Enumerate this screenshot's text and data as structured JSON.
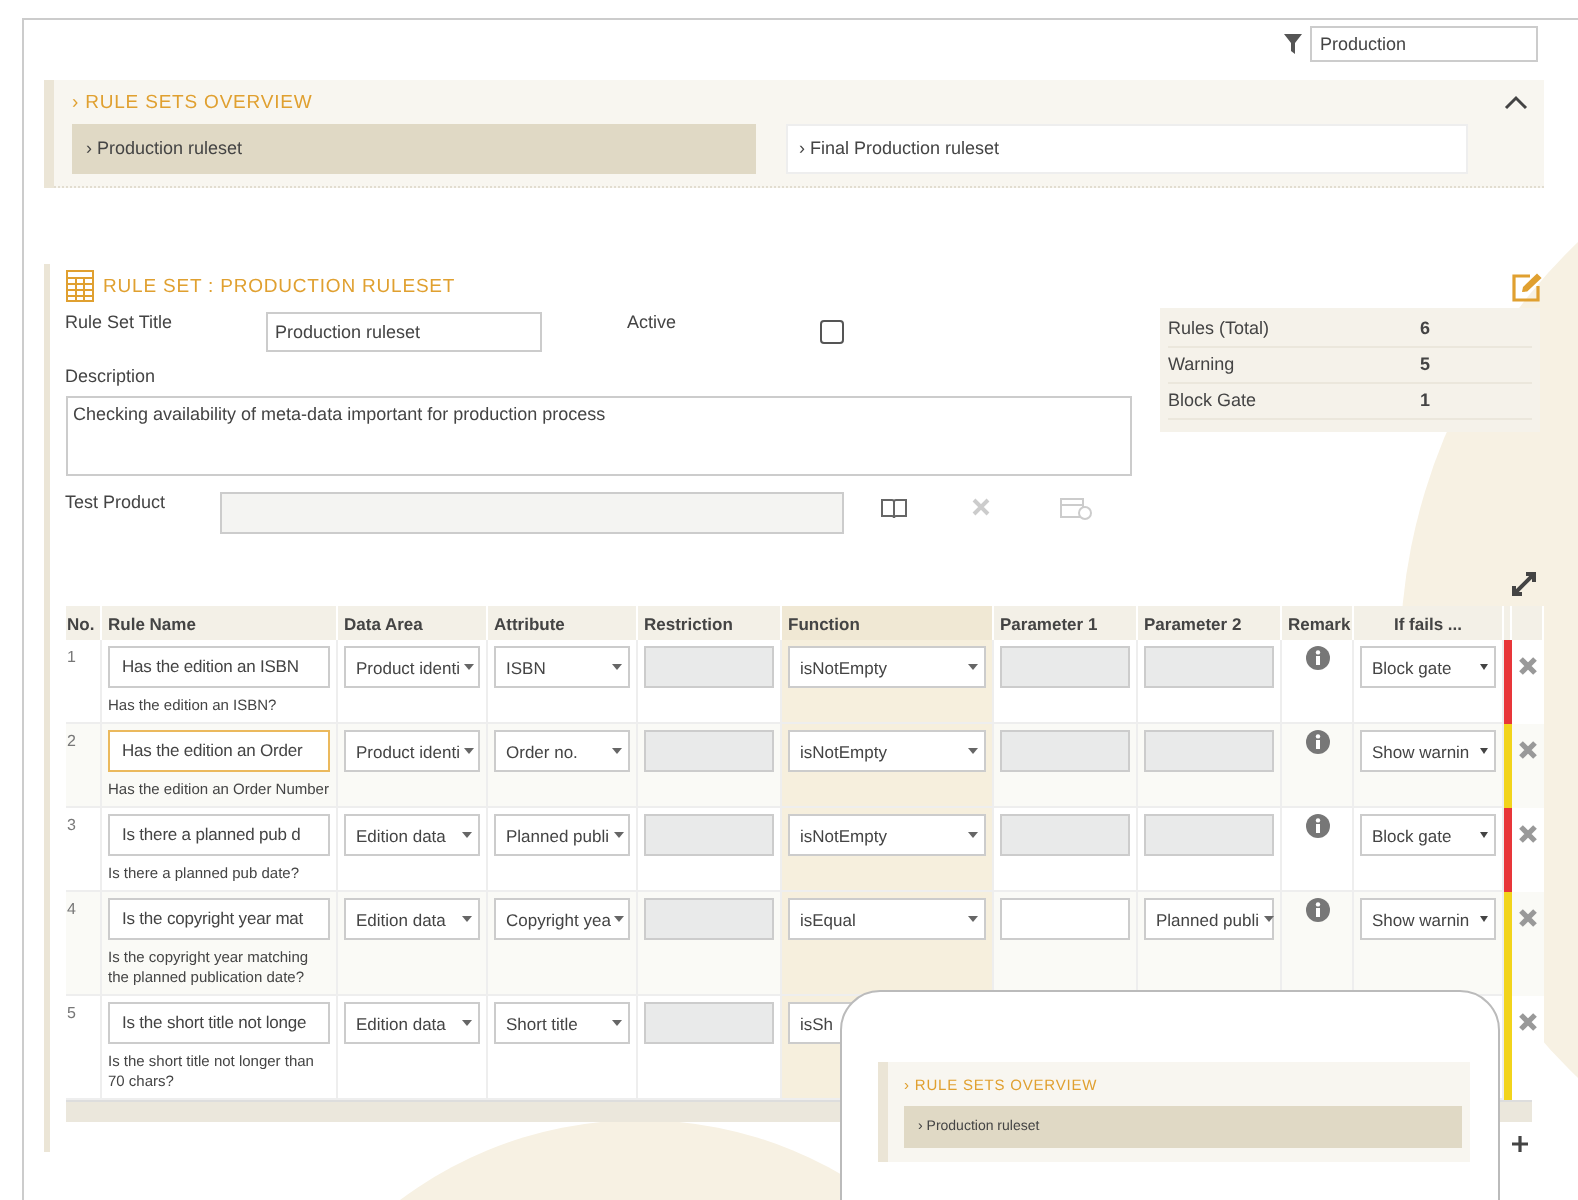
{
  "filter": {
    "value": "Production"
  },
  "overview": {
    "title": "› RULE SETS OVERVIEW",
    "expanded": true,
    "items": [
      {
        "label": "› Production ruleset",
        "selected": true
      },
      {
        "label": "› Final Production ruleset",
        "selected": false
      }
    ]
  },
  "ruleset": {
    "title": "RULE SET : PRODUCTION RULESET",
    "title_label": "Rule Set Title",
    "title_value": "Production ruleset",
    "active_label": "Active",
    "active": false,
    "description_label": "Description",
    "description": "Checking availability of meta-data important for production process",
    "test_product_label": "Test Product",
    "stats": [
      {
        "label": "Rules (Total)",
        "value": "6"
      },
      {
        "label": "Warning",
        "value": "5"
      },
      {
        "label": "Block Gate",
        "value": "1"
      }
    ]
  },
  "table": {
    "columns": [
      "No.",
      "Rule Name",
      "Data Area",
      "Attribute",
      "Restriction",
      "Function",
      "Parameter 1",
      "Parameter 2",
      "Remark",
      "If fails ..."
    ],
    "rows": [
      {
        "no": "1",
        "name": "Has the edition an ISBN",
        "focused": false,
        "description": "Has the edition an ISBN?",
        "data_area": "Product identi",
        "attribute": "ISBN",
        "function": "isNotEmpty",
        "parameter_1": {
          "kind": "disabled"
        },
        "parameter_2": {
          "kind": "disabled"
        },
        "remark": true,
        "if_fails": "Block gate",
        "color": "#e8363a"
      },
      {
        "no": "2",
        "name": "Has the edition an Order",
        "focused": true,
        "description": "Has the edition an Order Number",
        "data_area": "Product identi",
        "attribute": "Order no.",
        "function": "isNotEmpty",
        "parameter_1": {
          "kind": "disabled"
        },
        "parameter_2": {
          "kind": "disabled"
        },
        "remark": true,
        "if_fails": "Show warnin",
        "color": "#f2d41c"
      },
      {
        "no": "3",
        "name": "Is there a planned pub d",
        "focused": false,
        "description": "Is there a planned pub date?",
        "data_area": "Edition data",
        "attribute": "Planned publi",
        "function": "isNotEmpty",
        "parameter_1": {
          "kind": "disabled"
        },
        "parameter_2": {
          "kind": "disabled"
        },
        "remark": true,
        "if_fails": "Block gate",
        "color": "#e8363a"
      },
      {
        "no": "4",
        "name": "Is the copyright year mat",
        "focused": false,
        "description": "Is the copyright year matching the planned publication date?",
        "data_area": "Edition data",
        "attribute": "Copyright yea",
        "function": "isEqual",
        "parameter_1": {
          "kind": "input"
        },
        "parameter_2": {
          "kind": "select",
          "value": "Planned publi"
        },
        "remark": true,
        "if_fails": "Show warnin",
        "color": "#f2d41c"
      },
      {
        "no": "5",
        "name": "Is the short title not longe",
        "focused": false,
        "description": "Is the short title not longer than 70 chars?",
        "data_area": "Edition data",
        "attribute": "Short title",
        "function": "isSh",
        "parameter_1": {
          "kind": "hidden"
        },
        "parameter_2": {
          "kind": "hidden"
        },
        "remark": false,
        "color": "#f2d41c"
      }
    ]
  },
  "preview": {
    "title": "› RULE SETS OVERVIEW",
    "items": [
      {
        "label": "› Production ruleset",
        "selected": true
      }
    ]
  }
}
